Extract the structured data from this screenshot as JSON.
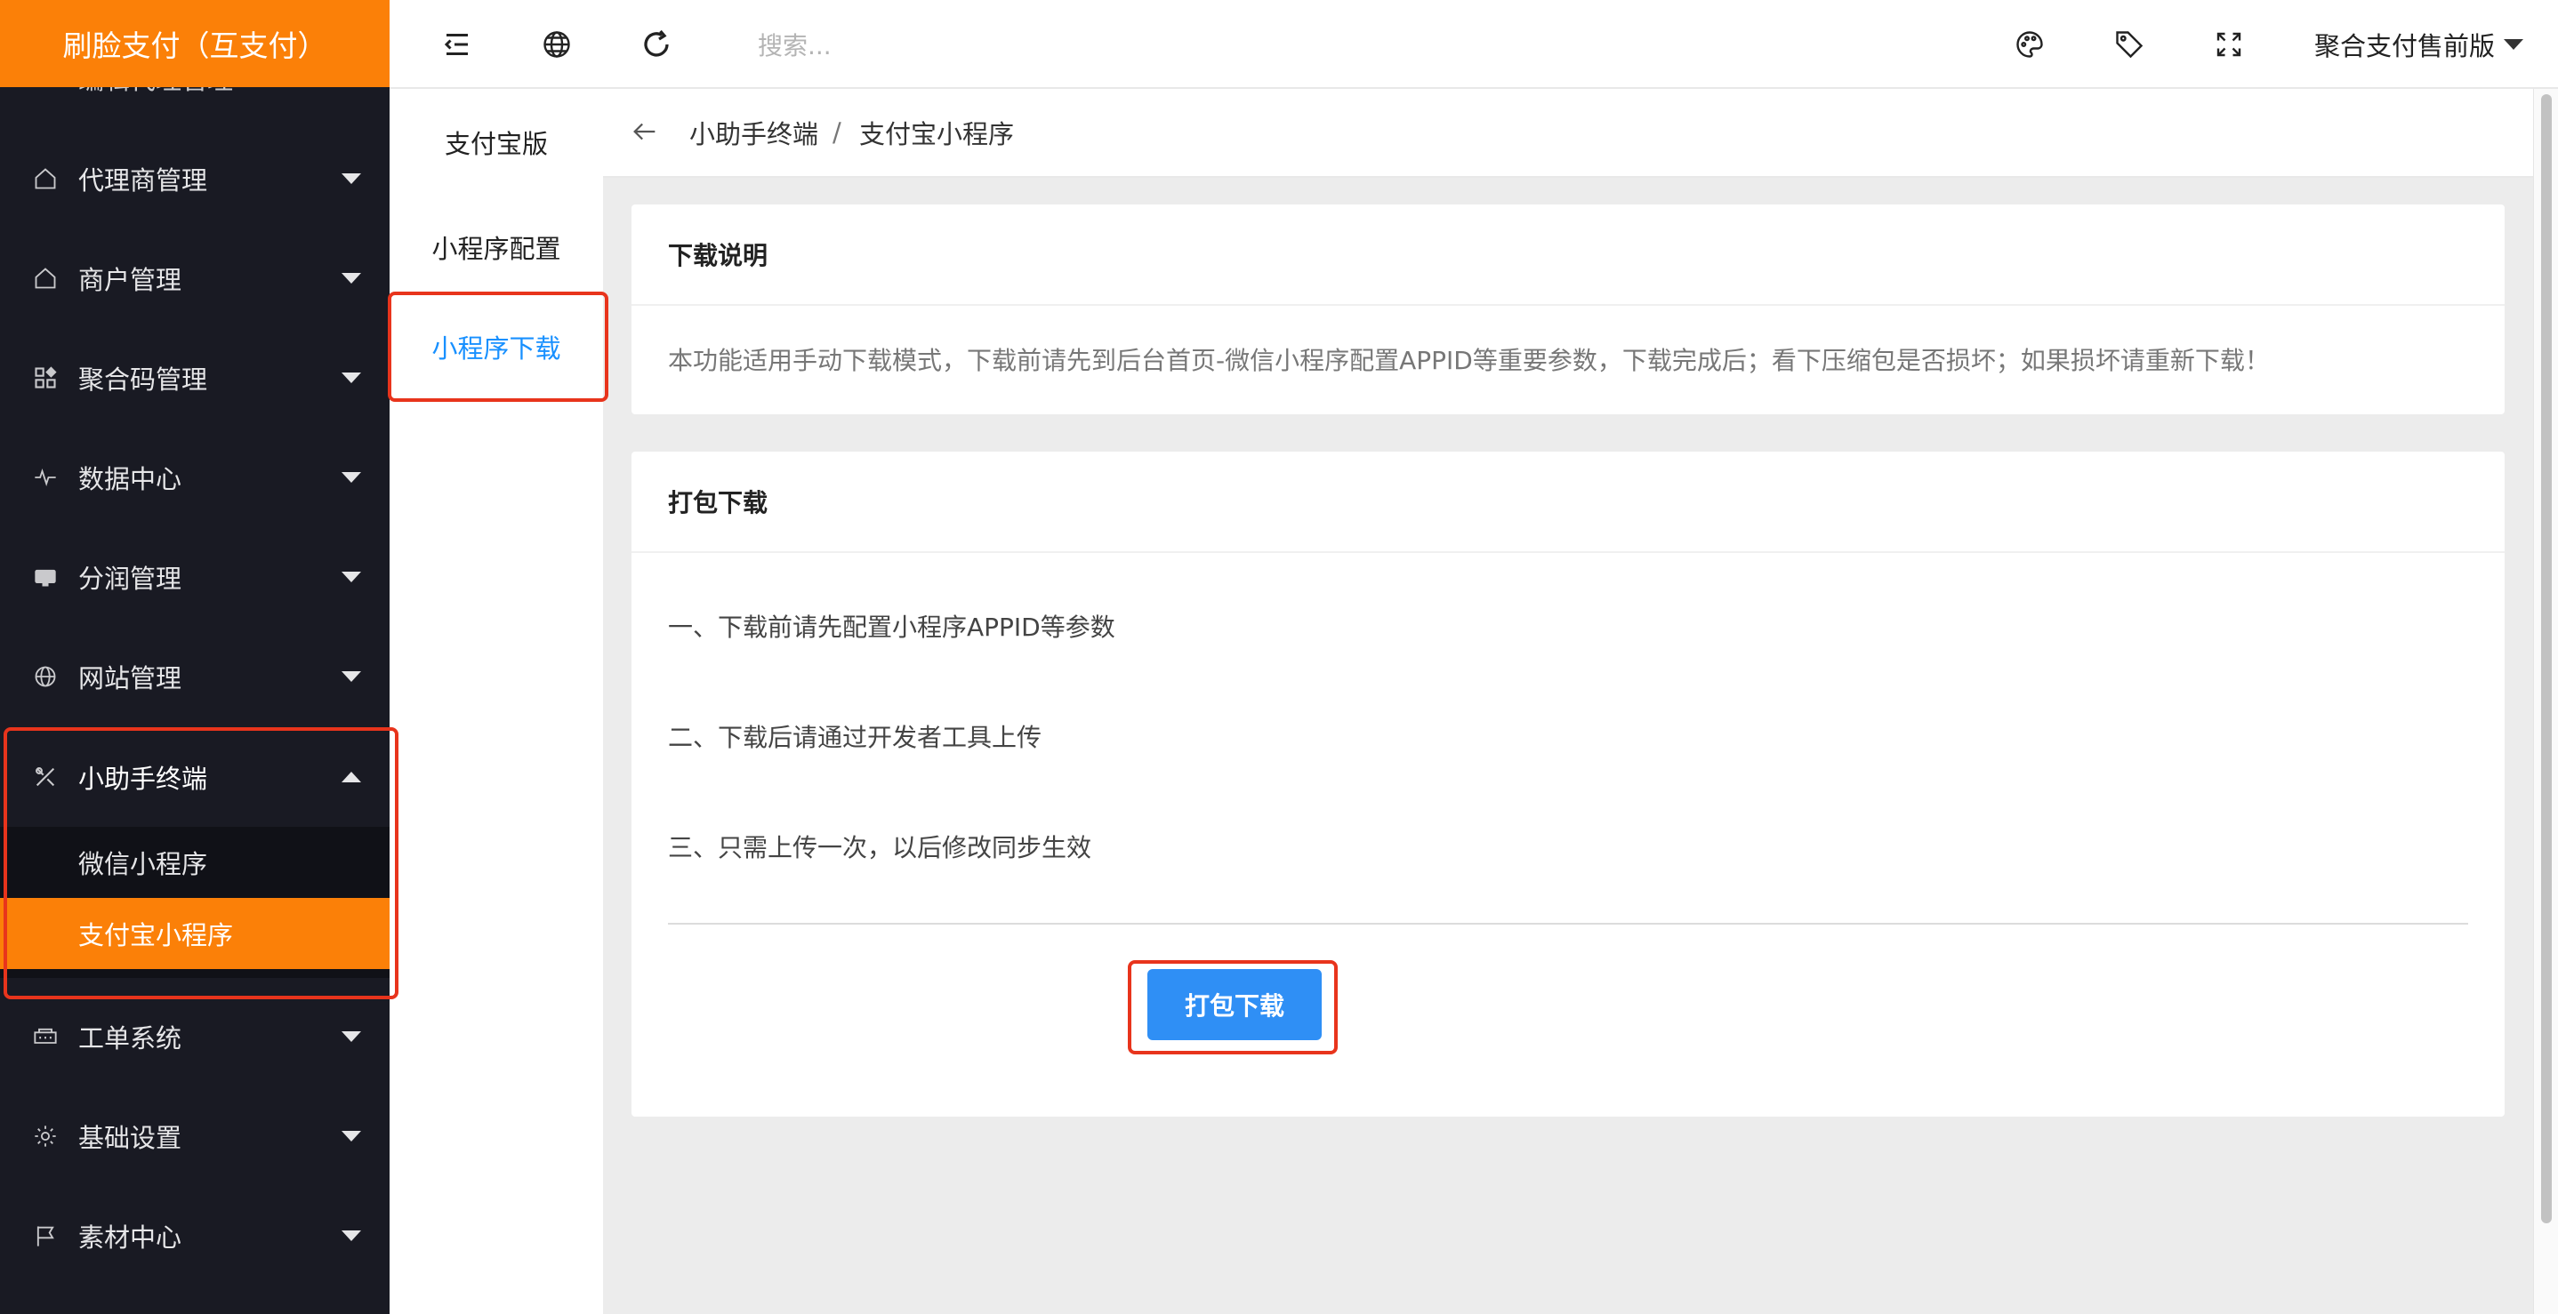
{
  "colors": {
    "brand_orange": "#fb8008",
    "sidebar_bg": "#191a23",
    "primary_blue": "#1890ff",
    "highlight_red": "#e8341c"
  },
  "logo": {
    "text": "刷脸支付（互支付）"
  },
  "sidebar": {
    "peek_label": "编辑代理管理",
    "items": [
      {
        "label": "代理商管理",
        "icon": "home-icon"
      },
      {
        "label": "商户管理",
        "icon": "home-icon"
      },
      {
        "label": "聚合码管理",
        "icon": "grid-icon"
      },
      {
        "label": "数据中心",
        "icon": "pulse-icon"
      },
      {
        "label": "分润管理",
        "icon": "money-icon"
      },
      {
        "label": "网站管理",
        "icon": "globe-icon"
      },
      {
        "label": "小助手终端",
        "icon": "tools-icon",
        "expanded": true
      },
      {
        "label": "工单系统",
        "icon": "ticket-icon"
      },
      {
        "label": "基础设置",
        "icon": "gear-icon"
      },
      {
        "label": "素材中心",
        "icon": "flag-icon"
      }
    ],
    "submenu": [
      {
        "label": "微信小程序",
        "active": false
      },
      {
        "label": "支付宝小程序",
        "active": true
      }
    ]
  },
  "header": {
    "icons": [
      "menu-fold-icon",
      "globe-icon",
      "refresh-icon",
      "palette-icon",
      "tag-icon",
      "fullscreen-icon"
    ],
    "search_placeholder": "搜索...",
    "version_label": "聚合支付售前版"
  },
  "subnav": {
    "items": [
      {
        "label": "支付宝版",
        "active": false
      },
      {
        "label": "小程序配置",
        "active": false
      },
      {
        "label": "小程序下载",
        "active": true
      }
    ]
  },
  "breadcrumb": {
    "parent": "小助手终端",
    "separator": "/",
    "current": "支付宝小程序"
  },
  "card_notice": {
    "title": "下载说明",
    "text": "本功能适用手动下载模式，下载前请先到后台首页-微信小程序配置APPID等重要参数，下载完成后；看下压缩包是否损坏；如果损坏请重新下载！"
  },
  "card_download": {
    "title": "打包下载",
    "steps": [
      "一、下载前请先配置小程序APPID等参数",
      "二、下载后请通过开发者工具上传",
      "三、只需上传一次，以后修改同步生效"
    ],
    "button_label": "打包下载"
  }
}
